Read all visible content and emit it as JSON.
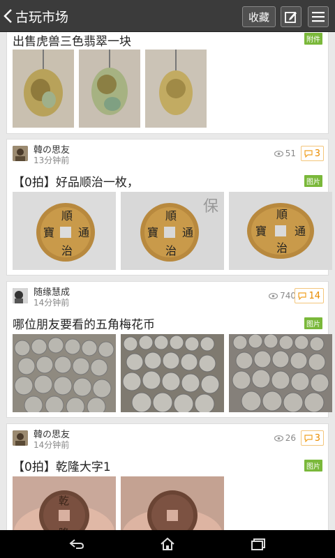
{
  "header": {
    "title": "古玩市场",
    "favorite_label": "收藏"
  },
  "posts": [
    {
      "title": "出售虎兽三色翡翠一块",
      "tag": "附件",
      "images": [
        "jade-1",
        "jade-2",
        "jade-3"
      ]
    },
    {
      "user": "韓の思友",
      "time": "13分钟前",
      "views": "51",
      "comments": "3",
      "title": "【0拍】好品顺治一枚，",
      "tag": "图片",
      "images": [
        "coin-1",
        "coin-2",
        "coin-3"
      ]
    },
    {
      "user": "随缘慧成",
      "time": "14分钟前",
      "views": "740",
      "comments": "14",
      "title": "哪位朋友要看的五角梅花币",
      "tag": "图片",
      "images": [
        "pile-1",
        "pile-2",
        "pile-3"
      ]
    },
    {
      "user": "韓の思友",
      "time": "14分钟前",
      "views": "26",
      "comments": "3",
      "title": "【0拍】乾隆大字1",
      "tag": "图片",
      "images": [
        "hand-coin-1",
        "hand-coin-2"
      ]
    }
  ],
  "colors": {
    "topbar": "#3b3b3b",
    "tag_green": "#7ab83a",
    "comment_orange": "#e88b00"
  },
  "icons": {
    "back": "chevron-left-icon",
    "edit": "pencil-square-icon",
    "menu": "hamburger-menu-icon",
    "views": "eye-icon",
    "comments": "speech-bubble-icon",
    "nav": [
      "back-arrow-icon",
      "home-icon",
      "recent-apps-icon"
    ]
  }
}
